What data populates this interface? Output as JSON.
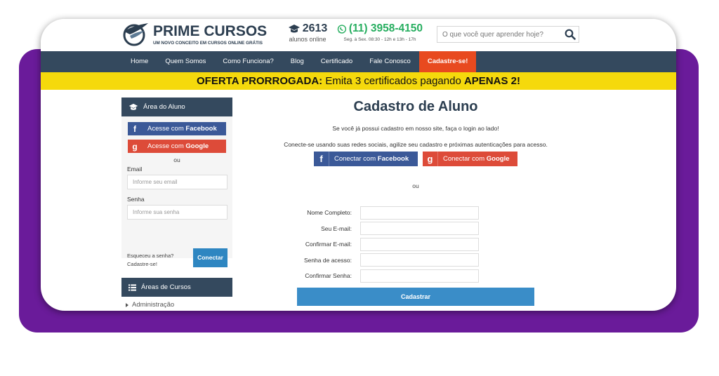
{
  "header": {
    "logo_title": "PRIME CURSOS",
    "logo_subtitle": "UM NOVO CONCEITO EM CURSOS ONLINE GRÁTIS",
    "students_count": "2613",
    "students_label": "alunos online",
    "phone": "(11) 3958-4150",
    "hours": "Seg. à Sex. 08:30 - 12h e 13h - 17h",
    "search_placeholder": "O que você quer aprender hoje?"
  },
  "nav": {
    "items": [
      "Home",
      "Quem Somos",
      "Como Funciona?",
      "Blog",
      "Certificado",
      "Fale Conosco"
    ],
    "cta": "Cadastre-se!"
  },
  "offer": {
    "bold_start": "OFERTA PRORROGADA:",
    "middle": " Emita 3 certificados pagando ",
    "bold_end": "APENAS 2!"
  },
  "sidebar": {
    "title": "Área do Aluno",
    "fb_prefix": "Acesse com ",
    "fb_brand": "Facebook",
    "google_prefix": "Acesse com ",
    "google_brand": "Google",
    "or": "ou",
    "email_label": "Email",
    "email_placeholder": "Informe seu email",
    "password_label": "Senha",
    "password_placeholder": "Informe sua senha",
    "forgot": "Esqueceu a senha?",
    "signup": "Cadastre-se!",
    "connect": "Conectar"
  },
  "areas": {
    "title": "Áreas de Cursos",
    "first_item": "Administração"
  },
  "main": {
    "title": "Cadastro de Aluno",
    "login_hint": "Se você já possui cadastro em nosso site, faça o login ao lado!",
    "social_hint": "Conecte-se usando suas redes sociais, agilize seu cadastro e próximas autenticações para acesso.",
    "fb_prefix": "Conectar com ",
    "fb_brand": "Facebook",
    "google_prefix": "Conectar com ",
    "google_brand": "Google",
    "or": "ou",
    "fields": [
      "Nome Completo:",
      "Seu E-mail:",
      "Confirmar E-mail:",
      "Senha de acesso:",
      "Confirmar Senha:"
    ],
    "submit": "Cadastrar"
  },
  "colors": {
    "frame_purple": "#6a1b9a",
    "nav_bg": "#34495e",
    "cta_orange": "#e84a1f",
    "offer_yellow": "#f5d90c",
    "facebook_blue": "#3b5998",
    "google_red": "#dd4b39",
    "submit_blue": "#3a8dc8",
    "phone_green": "#27ae60"
  }
}
